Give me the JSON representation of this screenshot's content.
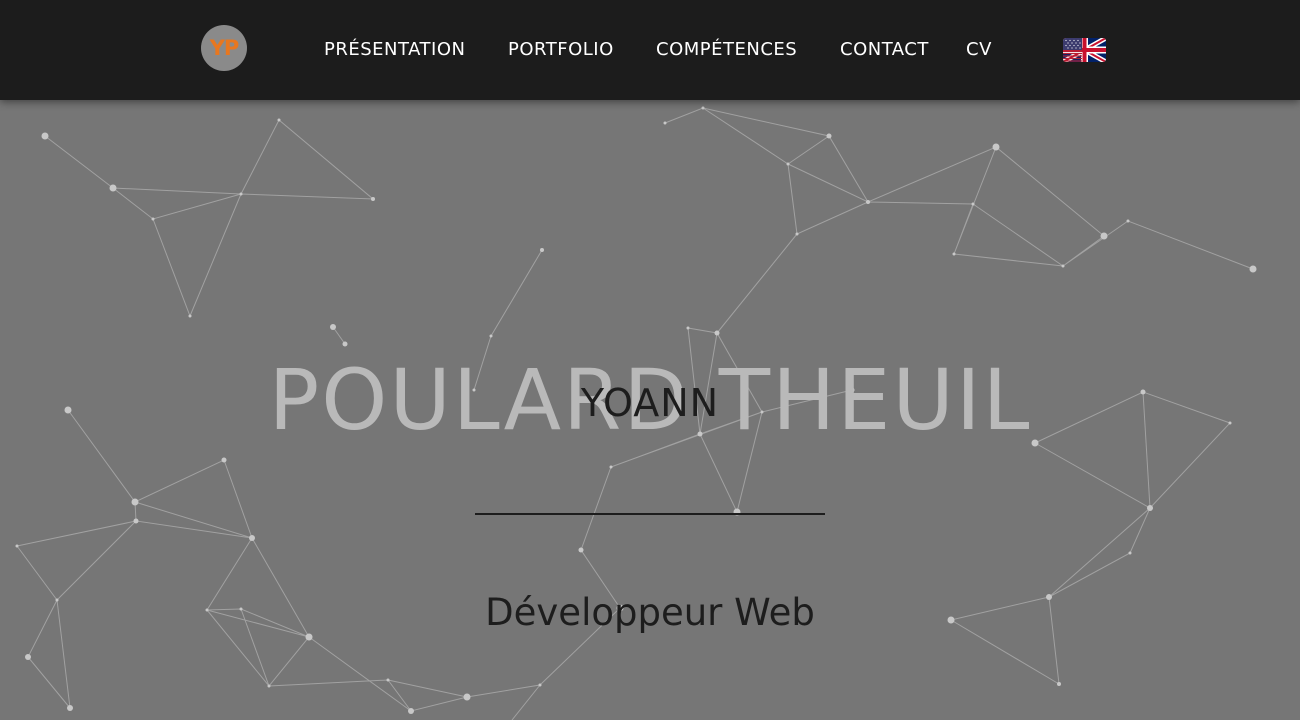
{
  "header": {
    "logo_text": "YP",
    "nav": [
      {
        "label": "PRÉSENTATION"
      },
      {
        "label": "PORTFOLIO"
      },
      {
        "label": "COMPÉTENCES"
      },
      {
        "label": "CONTACT"
      },
      {
        "label": "CV"
      }
    ],
    "language_icon": "uk-flag-icon"
  },
  "hero": {
    "surname": "POULARD THEUIL",
    "firstname": "YOANN",
    "role": "Développeur Web"
  },
  "colors": {
    "header_bg": "#1c1c1c",
    "hero_bg": "#767676",
    "logo_accent": "#e8771f",
    "text_dark": "#1d1d1d",
    "surname_text": "#b9b9b9"
  }
}
